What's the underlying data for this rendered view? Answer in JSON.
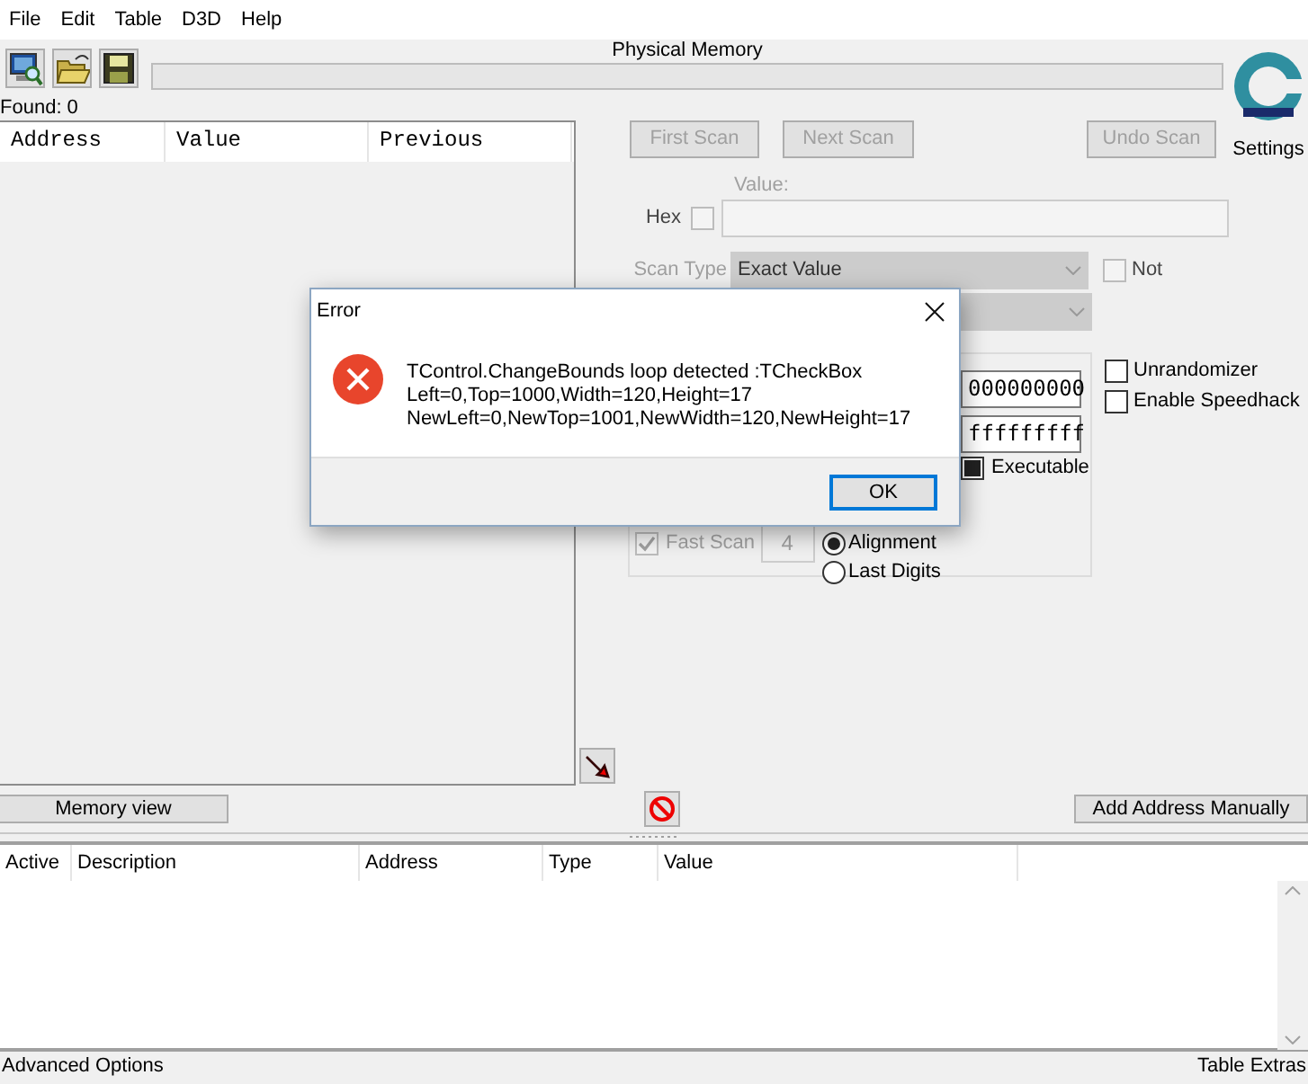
{
  "menu": [
    "File",
    "Edit",
    "Table",
    "D3D",
    "Help"
  ],
  "process_label": "Physical Memory",
  "progress": {
    "level": 0
  },
  "found": "Found: 0",
  "results_table": {
    "columns": [
      "Address",
      "Value",
      "Previous"
    ]
  },
  "logo": {
    "label": "Settings"
  },
  "scan_buttons": [
    {
      "label": "First Scan",
      "disabled": true
    },
    {
      "label": "Next Scan",
      "disabled": true
    },
    {
      "label": "Undo Scan",
      "disabled": true
    }
  ],
  "value": {
    "label": "Value:",
    "hex_label": "Hex",
    "hex_checked": false
  },
  "scan_type": {
    "label": "Scan Type",
    "value": "Exact Value",
    "not_label": "Not",
    "not_checked": false
  },
  "memory_options": {
    "start": "000000000",
    "stop": "fffffffff",
    "executable": {
      "label": "Executable",
      "indeterminate": true
    },
    "fast_scan": {
      "label": "Fast Scan",
      "checked": true
    },
    "alignment_value": "4",
    "radios": [
      {
        "label": "Alignment",
        "selected": true
      },
      {
        "label": "Last Digits",
        "selected": false
      }
    ]
  },
  "extra_options": [
    {
      "label": "Unrandomizer",
      "checked": false
    },
    {
      "label": "Enable Speedhack",
      "checked": false
    }
  ],
  "memory_view_button": "Memory view",
  "add_address_button": "Add Address Manually",
  "address_list": {
    "columns": [
      "Active",
      "Description",
      "Address",
      "Type",
      "Value"
    ]
  },
  "status_bar": {
    "left": "Advanced Options",
    "right": "Table Extras"
  },
  "dialog": {
    "title": "Error",
    "message": "TControl.ChangeBounds loop detected :TCheckBox\nLeft=0,Top=1000,Width=120,Height=17\nNewLeft=0,NewTop=1001,NewWidth=120,NewHeight=17",
    "ok": "OK"
  }
}
